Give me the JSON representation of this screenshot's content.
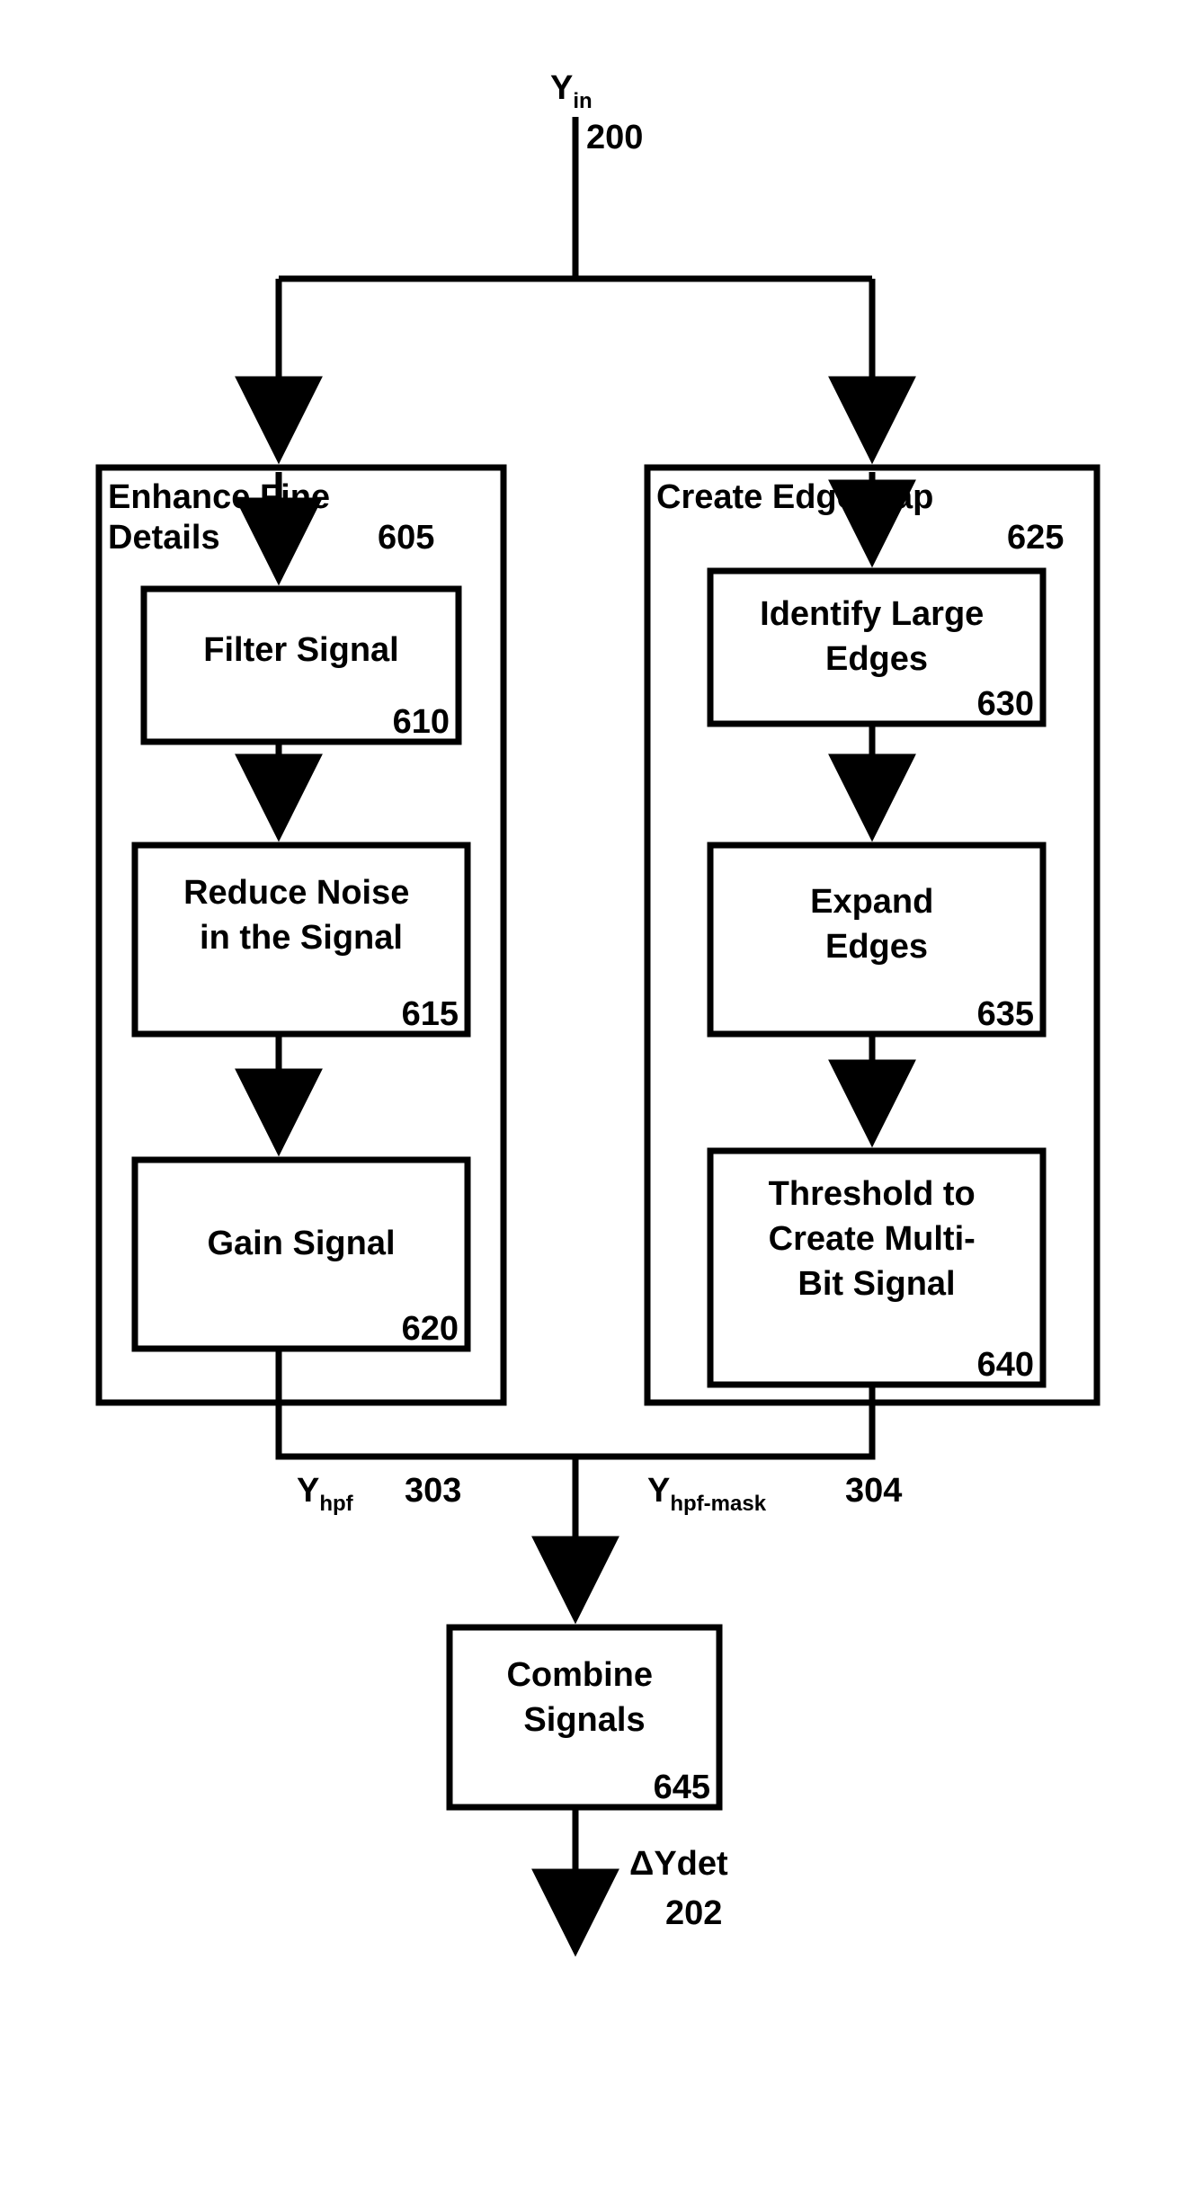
{
  "input": {
    "label": "Y",
    "sub": "in",
    "ref": "200"
  },
  "left": {
    "title": "Enhance Fine Details",
    "ref": "605",
    "b1": {
      "label": "Filter Signal",
      "ref": "610"
    },
    "b2": {
      "l1": "Reduce Noise",
      "l2": "in the Signal",
      "ref": "615"
    },
    "b3": {
      "label": "Gain Signal",
      "ref": "620"
    },
    "out": {
      "label": "Y",
      "sub": "hpf",
      "ref": "303"
    }
  },
  "right": {
    "title": "Create Edge Map",
    "ref": "625",
    "b1": {
      "l1": "Identify Large",
      "l2": "Edges",
      "ref": "630"
    },
    "b2": {
      "l1": "Expand",
      "l2": "Edges",
      "ref": "635"
    },
    "b3": {
      "l1": "Threshold to",
      "l2": "Create Multi-",
      "l3": "Bit Signal",
      "ref": "640"
    },
    "out": {
      "label": "Y",
      "sub": "hpf-mask",
      "ref": "304"
    }
  },
  "combine": {
    "l1": "Combine",
    "l2": "Signals",
    "ref": "645"
  },
  "output": {
    "label": "ΔYdet",
    "ref": "202"
  },
  "chart_data": {
    "type": "flowchart",
    "nodes": [
      {
        "id": "Yin",
        "label": "Y_in",
        "ref": "200"
      },
      {
        "id": "G605",
        "label": "Enhance Fine Details",
        "ref": "605",
        "children": [
          "610",
          "615",
          "620"
        ]
      },
      {
        "id": "610",
        "label": "Filter Signal",
        "ref": "610"
      },
      {
        "id": "615",
        "label": "Reduce Noise in the Signal",
        "ref": "615"
      },
      {
        "id": "620",
        "label": "Gain Signal",
        "ref": "620"
      },
      {
        "id": "G625",
        "label": "Create Edge Map",
        "ref": "625",
        "children": [
          "630",
          "635",
          "640"
        ]
      },
      {
        "id": "630",
        "label": "Identify Large Edges",
        "ref": "630"
      },
      {
        "id": "635",
        "label": "Expand Edges",
        "ref": "635"
      },
      {
        "id": "640",
        "label": "Threshold to Create Multi-Bit Signal",
        "ref": "640"
      },
      {
        "id": "645",
        "label": "Combine Signals",
        "ref": "645"
      },
      {
        "id": "dYdet",
        "label": "ΔYdet",
        "ref": "202"
      }
    ],
    "edges": [
      {
        "from": "Yin",
        "to": "G605"
      },
      {
        "from": "Yin",
        "to": "G625"
      },
      {
        "from": "610",
        "to": "615"
      },
      {
        "from": "615",
        "to": "620"
      },
      {
        "from": "630",
        "to": "635"
      },
      {
        "from": "635",
        "to": "640"
      },
      {
        "from": "620",
        "to": "645",
        "label": "Y_hpf",
        "ref": "303"
      },
      {
        "from": "640",
        "to": "645",
        "label": "Y_hpf-mask",
        "ref": "304"
      },
      {
        "from": "645",
        "to": "dYdet"
      }
    ]
  }
}
